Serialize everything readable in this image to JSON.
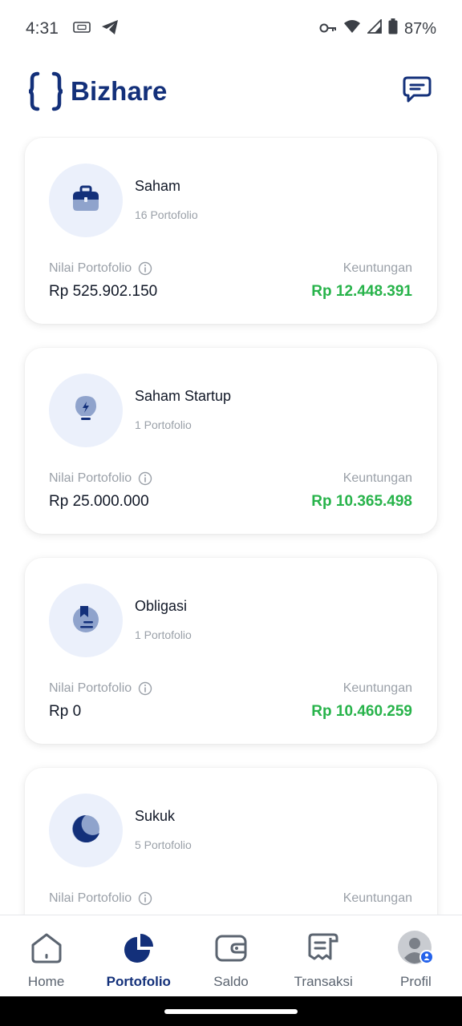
{
  "status_bar": {
    "time": "4:31",
    "battery": "87%"
  },
  "header": {
    "brand": "Bizhare"
  },
  "colors": {
    "brand_navy": "#13307a",
    "profit_green": "#27b34a",
    "muted": "#9aa0a8",
    "icon_bg": "#ebf0fb"
  },
  "portfolio_cards": [
    {
      "title": "Saham",
      "count": "16 Portofolio",
      "value_label": "Nilai Portofolio",
      "value": "Rp 525.902.150",
      "profit_label": "Keuntungan",
      "profit": "Rp 12.448.391",
      "icon": "briefcase-icon"
    },
    {
      "title": "Saham Startup",
      "count": "1 Portofolio",
      "value_label": "Nilai Portofolio",
      "value": "Rp 25.000.000",
      "profit_label": "Keuntungan",
      "profit": "Rp 10.365.498",
      "icon": "lightbulb-icon"
    },
    {
      "title": "Obligasi",
      "count": "1 Portofolio",
      "value_label": "Nilai Portofolio",
      "value": "Rp 0",
      "profit_label": "Keuntungan",
      "profit": "Rp 10.460.259",
      "icon": "bond-document-icon"
    },
    {
      "title": "Sukuk",
      "count": "5 Portofolio",
      "value_label": "Nilai Portofolio",
      "value": "",
      "profit_label": "Keuntungan",
      "profit": "",
      "icon": "crescent-moon-icon"
    }
  ],
  "bottom_nav": [
    {
      "label": "Home",
      "icon": "home-icon",
      "active": false
    },
    {
      "label": "Portofolio",
      "icon": "pie-chart-icon",
      "active": true
    },
    {
      "label": "Saldo",
      "icon": "wallet-icon",
      "active": false
    },
    {
      "label": "Transaksi",
      "icon": "receipt-icon",
      "active": false
    },
    {
      "label": "Profil",
      "icon": "profile-avatar-icon",
      "active": false
    }
  ]
}
